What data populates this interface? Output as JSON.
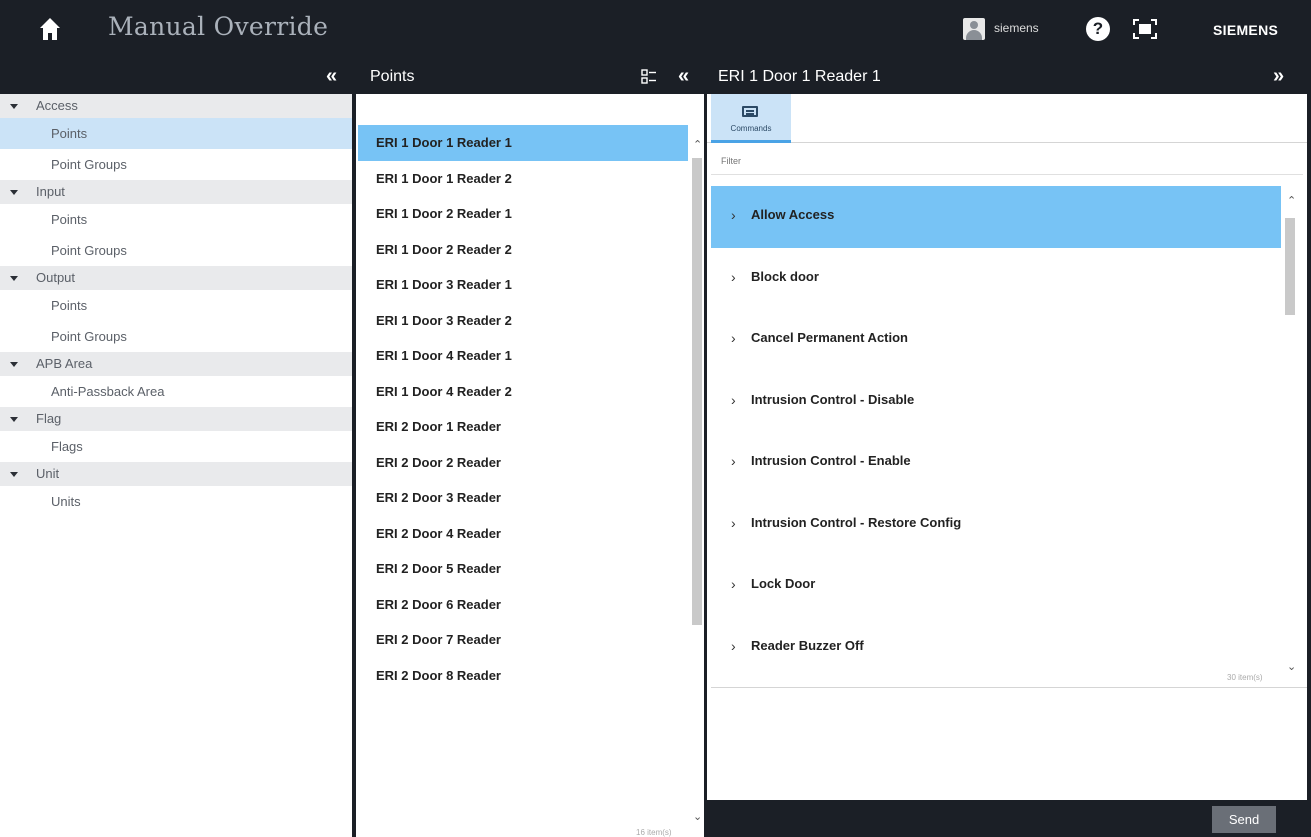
{
  "app": {
    "title": "Manual Override",
    "user_name": "siemens",
    "brand": "SIEMENS",
    "icons": {
      "home": "home-icon",
      "user": "user-avatar-icon",
      "help": "help-icon",
      "fullscreen": "fullscreen-icon"
    }
  },
  "left_panel": {
    "collapse_glyph": "«",
    "tree": [
      {
        "label": "Access",
        "items": [
          "Points",
          "Point Groups"
        ]
      },
      {
        "label": "Input",
        "items": [
          "Points",
          "Point Groups"
        ]
      },
      {
        "label": "Output",
        "items": [
          "Points",
          "Point Groups"
        ]
      },
      {
        "label": "APB Area",
        "items": [
          "Anti-Passback Area"
        ]
      },
      {
        "label": "Flag",
        "items": [
          "Flags"
        ]
      },
      {
        "label": "Unit",
        "items": [
          "Units"
        ]
      }
    ],
    "selected": "Access/Points"
  },
  "middle_panel": {
    "title": "Points",
    "collapse_glyph": "«",
    "items": [
      "ERI 1 Door 1 Reader 1",
      "ERI 1 Door 1 Reader 2",
      "ERI 1 Door 2 Reader 1",
      "ERI 1 Door 2 Reader 2",
      "ERI 1 Door 3 Reader 1",
      "ERI 1 Door 3 Reader 2",
      "ERI 1 Door 4 Reader 1",
      "ERI 1 Door 4 Reader 2",
      "ERI 2 Door 1 Reader",
      "ERI 2 Door 2 Reader",
      "ERI 2 Door 3 Reader",
      "ERI 2 Door 4 Reader",
      "ERI 2 Door 5 Reader",
      "ERI 2 Door 6 Reader",
      "ERI 2 Door 7 Reader",
      "ERI 2 Door 8 Reader"
    ],
    "selected_index": 0,
    "count_text": "16 item(s)"
  },
  "right_panel": {
    "title": "ERI 1 Door 1 Reader 1",
    "expand_glyph": "»",
    "tab_label": "Commands",
    "filter_placeholder": "Filter",
    "commands": [
      "Allow Access",
      "Block door",
      "Cancel Permanent Action",
      "Intrusion Control - Disable",
      "Intrusion Control - Enable",
      "Intrusion Control - Restore Config",
      "Lock Door",
      "Reader Buzzer Off"
    ],
    "selected_index": 0,
    "count_text": "30 item(s)",
    "send_label": "Send"
  }
}
